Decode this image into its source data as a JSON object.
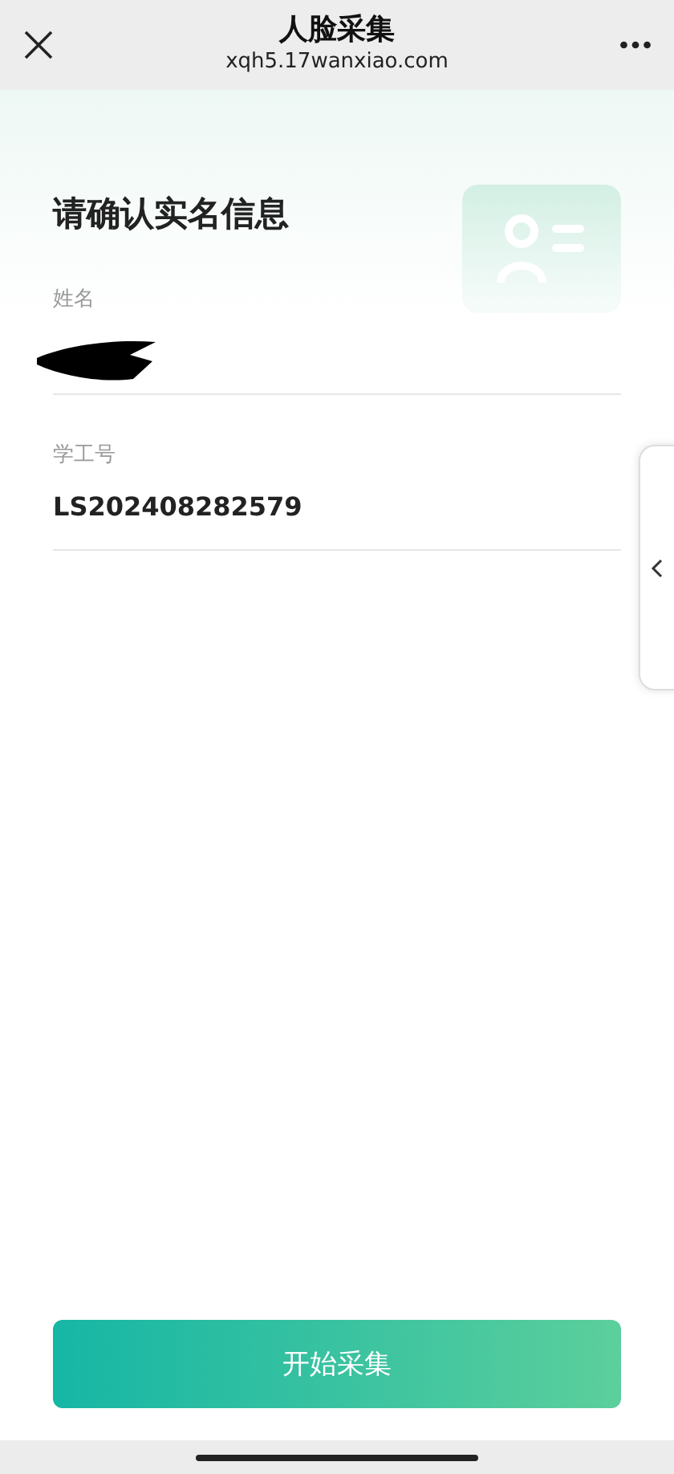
{
  "header": {
    "title": "人脸采集",
    "subtitle": "xqh5.17wanxiao.com"
  },
  "heading": "请确认实名信息",
  "fields": [
    {
      "label": "姓名",
      "redacted": true
    },
    {
      "label": "学工号",
      "value": "LS202408282579",
      "redacted": false
    }
  ],
  "button": "开始采集"
}
